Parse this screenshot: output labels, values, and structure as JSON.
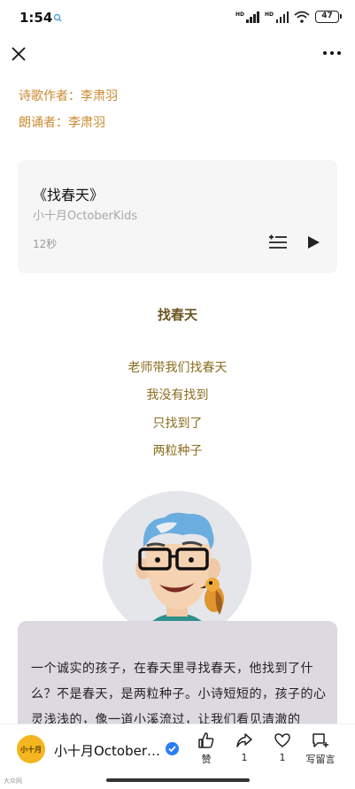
{
  "status": {
    "time": "1:54",
    "battery": "47",
    "network_1": "HD",
    "network_2": "HD"
  },
  "credits": {
    "poet": "诗歌作者：李肃羽",
    "reader": "朗诵者：李肃羽"
  },
  "audio": {
    "title": "《找春天》",
    "author": "小十月OctoberKids",
    "duration": "12秒"
  },
  "poem": {
    "title": "找春天",
    "lines": [
      "老师带我们找春天",
      "我没有找到",
      "只找到了",
      "两粒种子"
    ]
  },
  "description": "一个诚实的孩子，在春天里寻找春天，他找到了什么？不是春天，是两粒种子。小诗短短的，孩子的心灵浅浅的，像一道小溪流过，让我们看见清澈的",
  "account": {
    "name": "小十月October…",
    "avatar_text": "小十月"
  },
  "actions": {
    "like": "赞",
    "share": "1",
    "favorite": "1",
    "comment": "写留言"
  },
  "watermark": "大众网",
  "colors": {
    "credit": "#c98a2e",
    "poem": "#8a6d1e",
    "card_bg": "#f6f6f6",
    "desc_bg": "#ddd9e1",
    "verified": "#2c7ef8"
  }
}
